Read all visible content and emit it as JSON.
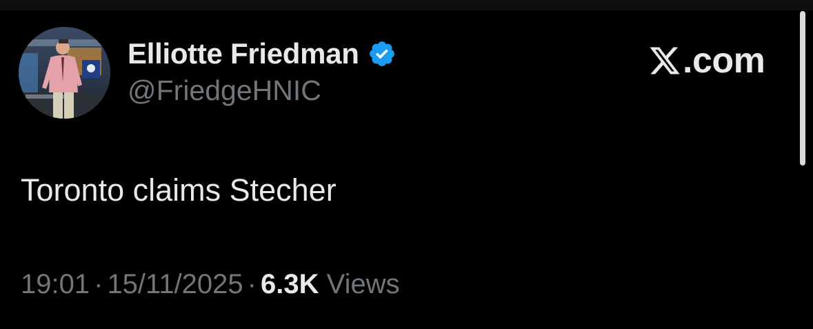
{
  "tweet": {
    "author": {
      "name": "Elliotte Friedman",
      "handle": "@FriedgeHNIC",
      "verified": true,
      "badge_color": "#1d9bf0"
    },
    "brand": {
      "icon": "x-logo-icon",
      "text": ".com"
    },
    "text": "Toronto claims Stecher",
    "meta": {
      "time": "19:01",
      "separator": "·",
      "date": "15/11/2025",
      "views_count": "6.3K",
      "views_label": "Views"
    }
  },
  "colors": {
    "background": "#000000",
    "primary_text": "#e7e9ea",
    "secondary_text": "#71767b"
  }
}
